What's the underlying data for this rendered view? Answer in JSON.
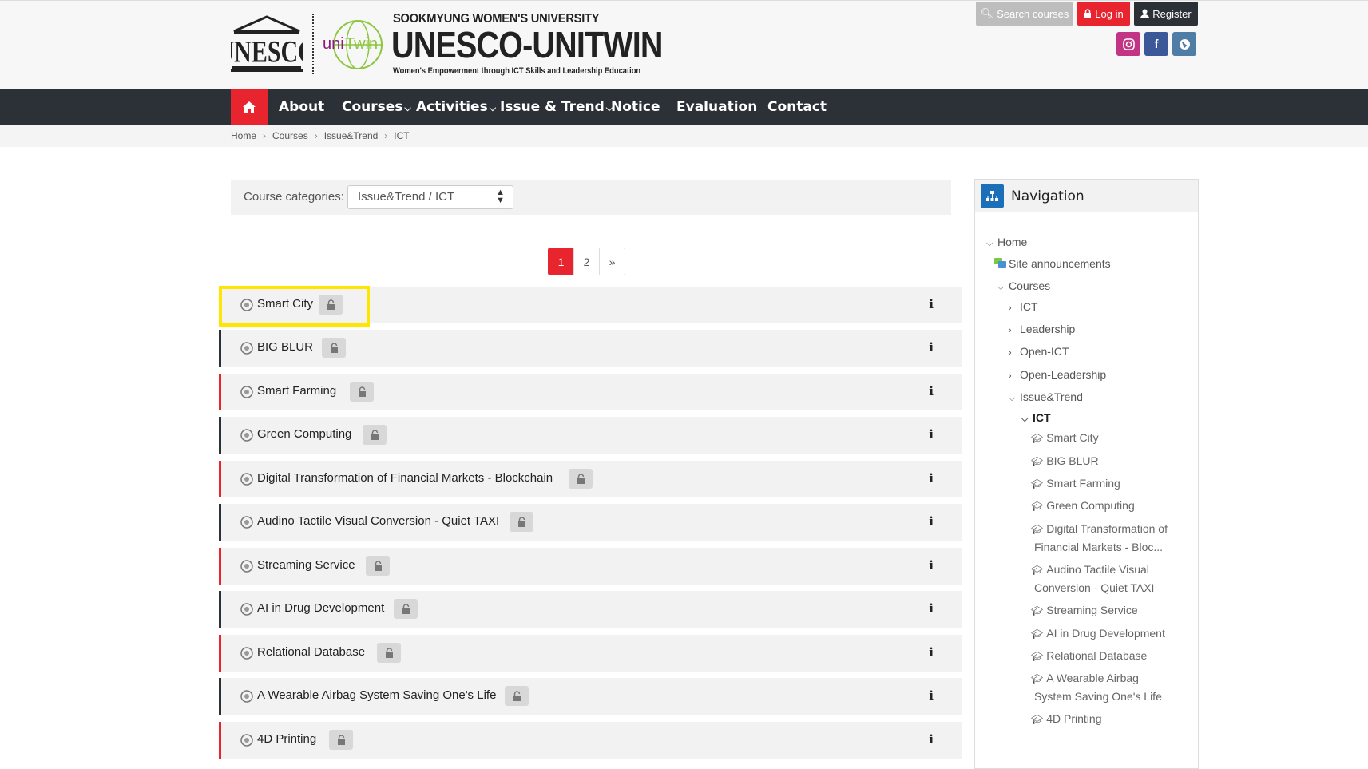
{
  "header": {
    "university": "SOOKMYUNG WOMEN'S UNIVERSITY",
    "title": "UNESCO-UNITWIN",
    "tagline": "Women's Empowerment through ICT Skills and Leadership Education",
    "unitwin_logo_text": "uniTwin",
    "unesco_logo_text": "UNESCO"
  },
  "top_buttons": {
    "search": "Search courses",
    "login": "Log in",
    "register": "Register"
  },
  "social": [
    "instagram-icon",
    "facebook-icon",
    "globe-icon"
  ],
  "nav": {
    "items": [
      {
        "label": "About"
      },
      {
        "label": "Courses",
        "caret": "⌵"
      },
      {
        "label": "Activities",
        "caret": "⌵"
      },
      {
        "label": "Issue & Trend",
        "caret": "⌵"
      },
      {
        "label": "Notice"
      },
      {
        "label": "Evaluation"
      },
      {
        "label": "Contact"
      }
    ]
  },
  "breadcrumb": [
    "Home",
    "Courses",
    "Issue&Trend",
    "ICT"
  ],
  "category": {
    "label": "Course categories:",
    "selected": "Issue&Trend / ICT"
  },
  "pagination": [
    "1",
    "2",
    "»"
  ],
  "courses": [
    {
      "name": "Smart City"
    },
    {
      "name": "BIG BLUR"
    },
    {
      "name": "Smart Farming"
    },
    {
      "name": "Green Computing"
    },
    {
      "name": "Digital Transformation of Financial Markets - Blockchain"
    },
    {
      "name": "Audino Tactile Visual Conversion - Quiet TAXI"
    },
    {
      "name": "Streaming Service"
    },
    {
      "name": "AI in Drug Development"
    },
    {
      "name": "Relational Database"
    },
    {
      "name": "A Wearable Airbag System Saving One's Life"
    },
    {
      "name": "4D Printing"
    }
  ],
  "info_glyph": "i",
  "navigation": {
    "title": "Navigation",
    "home": "Home",
    "site_announcements": "Site announcements",
    "courses": "Courses",
    "categories": [
      "ICT",
      "Leadership",
      "Open-ICT",
      "Open-Leadership",
      "Issue&Trend"
    ],
    "current": "ICT",
    "course_links": [
      "Smart City",
      "BIG BLUR",
      "Smart Farming",
      "Green Computing",
      "Digital Transformation of",
      "Financial Markets - Bloc...",
      "Audino Tactile Visual",
      "Conversion - Quiet TAXI",
      "Streaming Service",
      "AI in Drug Development",
      "Relational Database",
      "A Wearable Airbag",
      "System Saving One's Life",
      "4D Printing"
    ]
  },
  "colors": {
    "accent_red": "#e8242f",
    "dark_nav": "#2b3137",
    "highlight": "#ffe600",
    "nav_icon_blue": "#1b6eb8"
  }
}
